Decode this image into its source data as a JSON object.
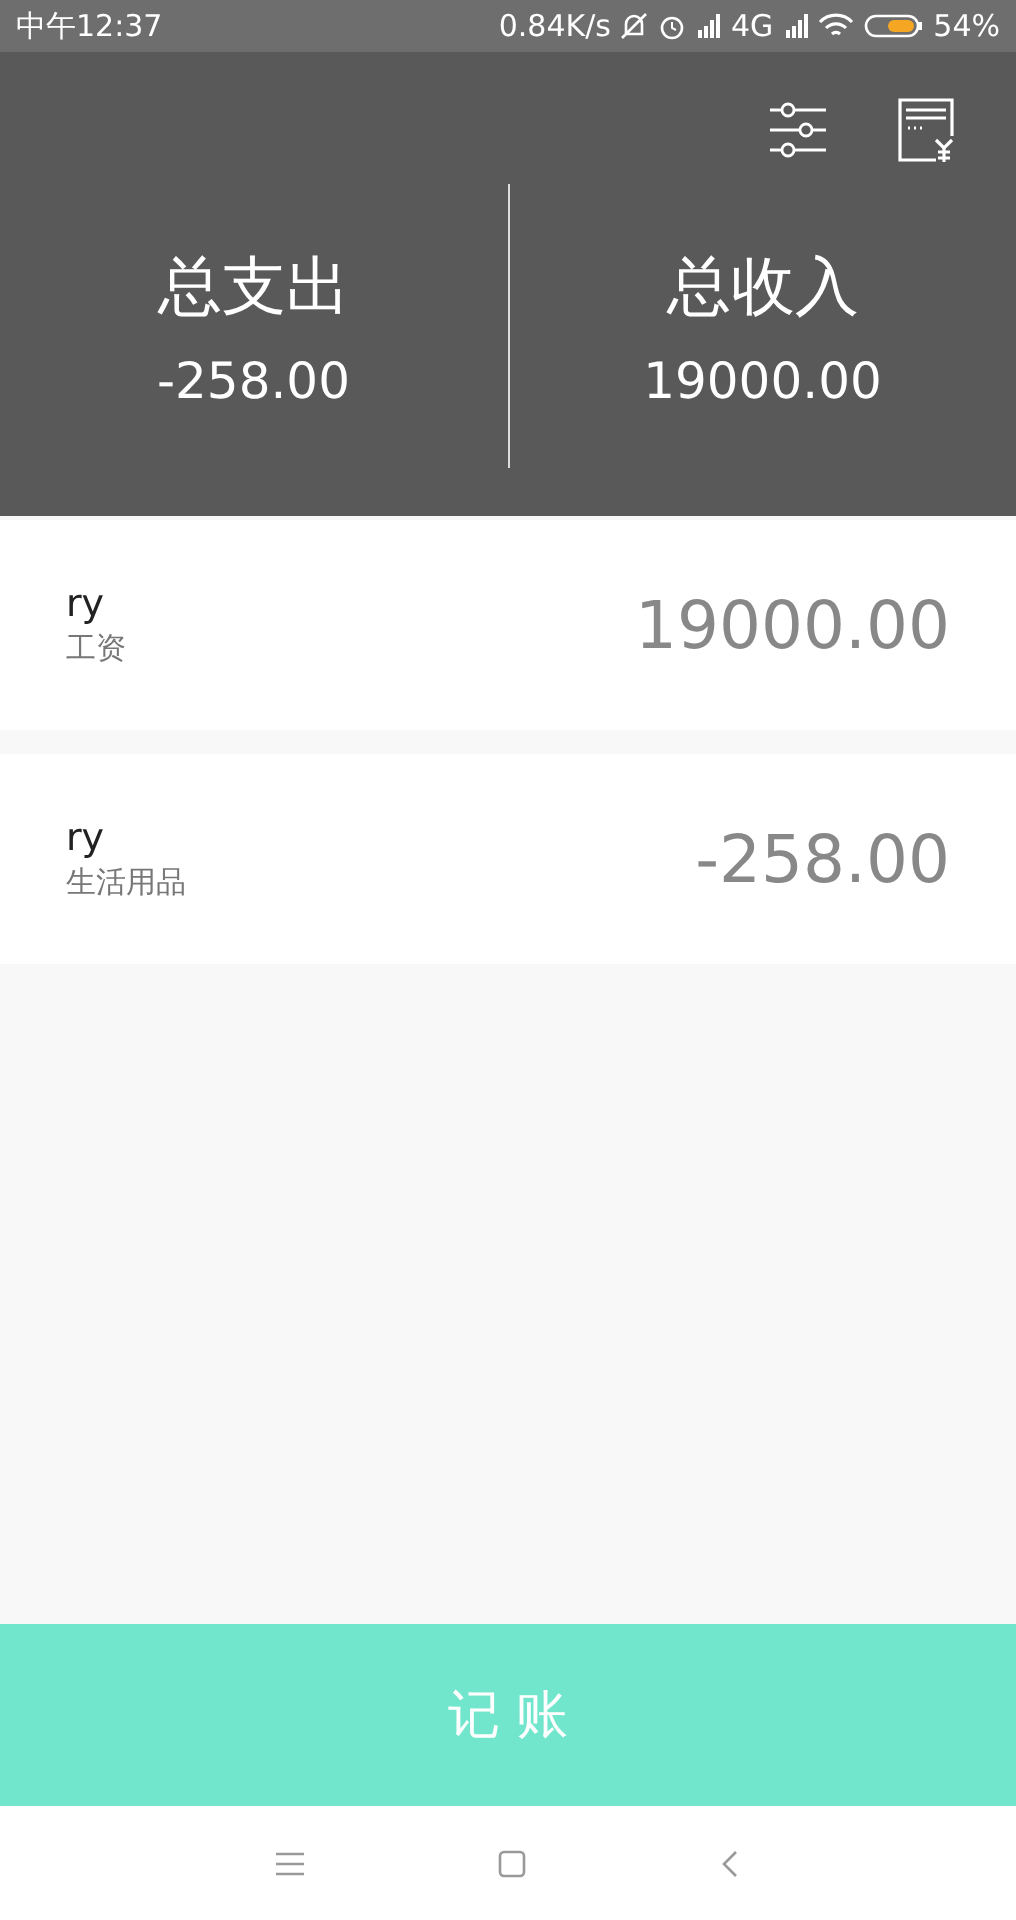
{
  "status_bar": {
    "time": "中午12:37",
    "speed": "0.84K/s",
    "network": "4G",
    "battery": "54%"
  },
  "summary": [
    {
      "label": "总支出",
      "amount": "-258.00"
    },
    {
      "label": "总收入",
      "amount": "19000.00"
    }
  ],
  "records": [
    {
      "name": "ry",
      "category": "工资",
      "amount": "19000.00"
    },
    {
      "name": "ry",
      "category": "生活用品",
      "amount": "-258.00"
    }
  ],
  "action_button": "记 账"
}
